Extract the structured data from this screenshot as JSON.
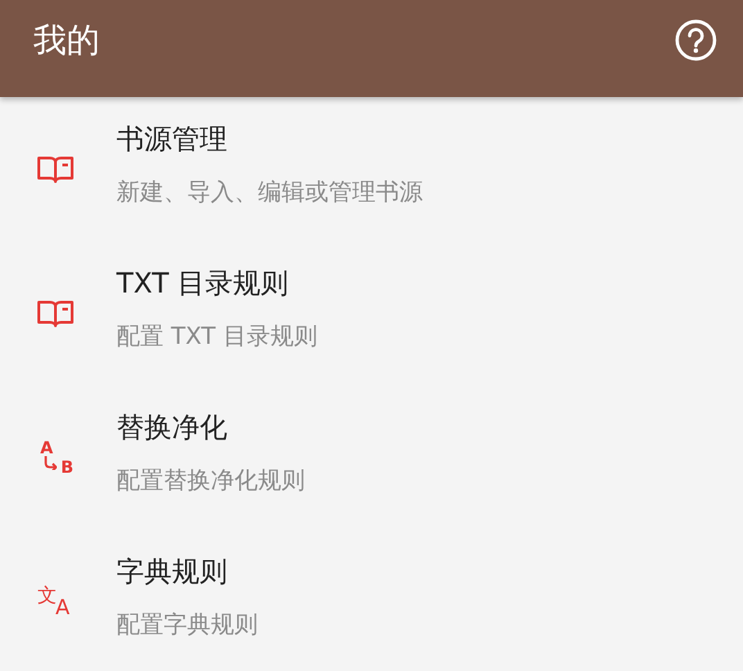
{
  "header": {
    "title": "我的"
  },
  "items": [
    {
      "title": "书源管理",
      "subtitle": "新建、导入、编辑或管理书源",
      "icon": {
        "kind": "book"
      }
    },
    {
      "title": "TXT 目录规则",
      "subtitle": "配置 TXT 目录规则",
      "icon": {
        "kind": "book"
      }
    },
    {
      "title": "替换净化",
      "subtitle": "配置替换净化规则",
      "icon": {
        "kind": "replace",
        "first": "A",
        "second": "B"
      }
    },
    {
      "title": "字典规则",
      "subtitle": "配置字典规则",
      "icon": {
        "kind": "translate",
        "first": "文",
        "second": "A"
      }
    }
  ]
}
